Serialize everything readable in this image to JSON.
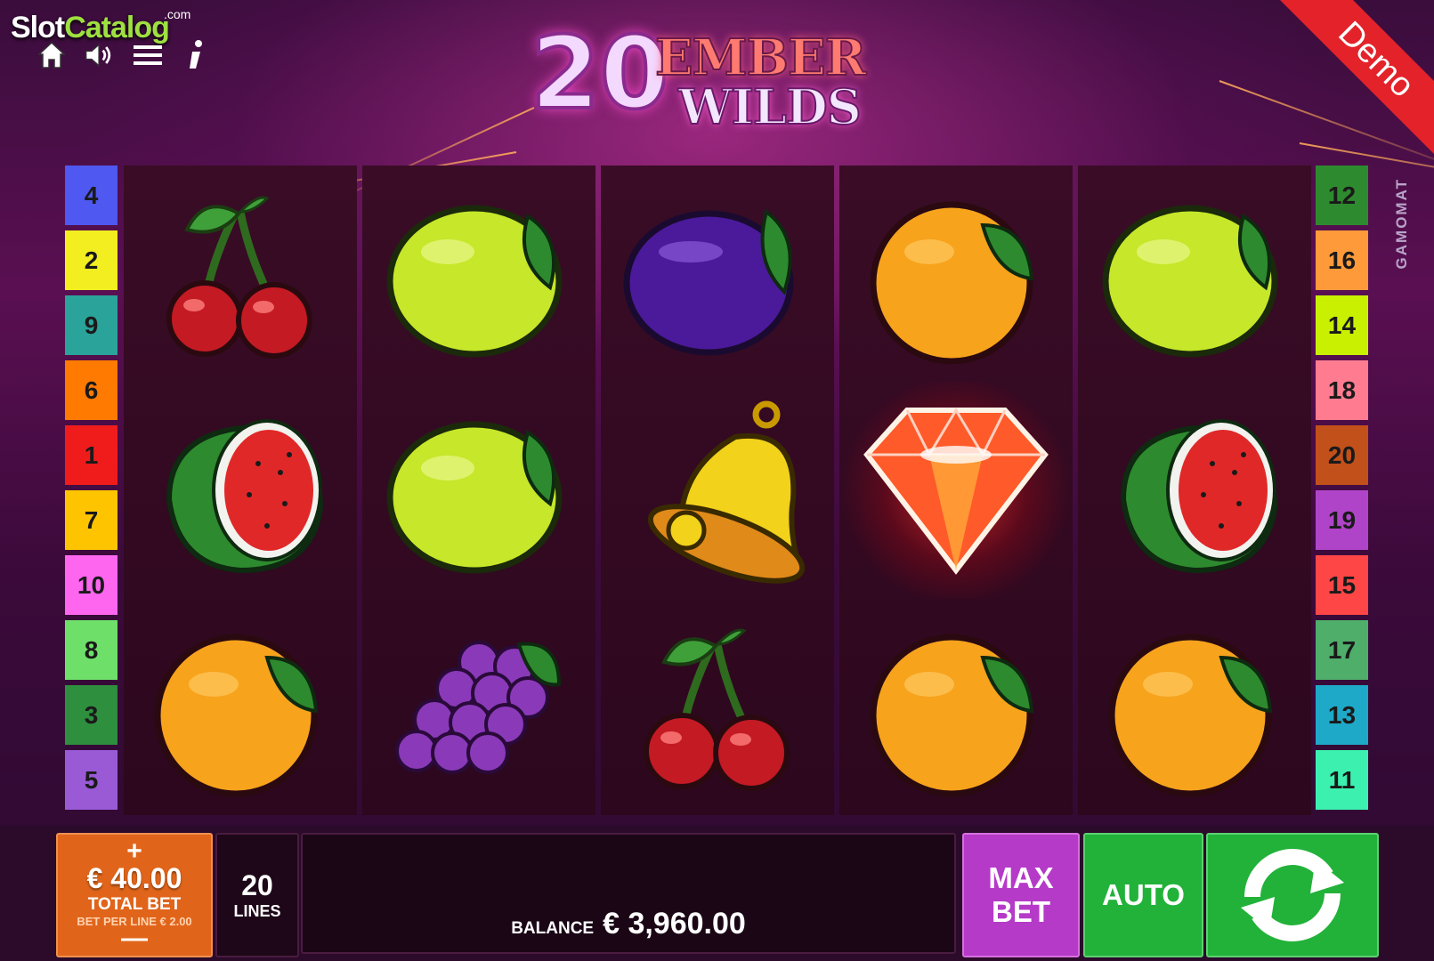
{
  "watermark": {
    "slot": "Slot",
    "catalog": "Catalog",
    "com": ".com"
  },
  "title": {
    "number": "20",
    "line1": "EMBER",
    "line2": "WILDS"
  },
  "demo_label": "Demo",
  "provider": "GAMOMAT",
  "top_icons": [
    "home-icon",
    "speaker-icon",
    "menu-icon",
    "info-icon"
  ],
  "lines_left": [
    {
      "n": "4",
      "color": "#4f58f0"
    },
    {
      "n": "2",
      "color": "#f2ee20"
    },
    {
      "n": "9",
      "color": "#2aa39a"
    },
    {
      "n": "6",
      "color": "#ff7a00"
    },
    {
      "n": "1",
      "color": "#f01c1c"
    },
    {
      "n": "7",
      "color": "#ffc400"
    },
    {
      "n": "10",
      "color": "#ff66f0"
    },
    {
      "n": "8",
      "color": "#6ee06a"
    },
    {
      "n": "3",
      "color": "#2e8f3e"
    },
    {
      "n": "5",
      "color": "#9a5ad6"
    }
  ],
  "lines_right": [
    {
      "n": "12",
      "color": "#2e8a2e"
    },
    {
      "n": "16",
      "color": "#ff9a3a"
    },
    {
      "n": "14",
      "color": "#c8f000"
    },
    {
      "n": "18",
      "color": "#ff7c90"
    },
    {
      "n": "20",
      "color": "#c2501a"
    },
    {
      "n": "19",
      "color": "#b044c8"
    },
    {
      "n": "15",
      "color": "#ff4646"
    },
    {
      "n": "17",
      "color": "#4eae6a"
    },
    {
      "n": "13",
      "color": "#1ea9c8"
    },
    {
      "n": "11",
      "color": "#3cf0b0"
    }
  ],
  "reels": [
    [
      "cherry",
      "watermelon",
      "orange"
    ],
    [
      "lemon",
      "lemon",
      "grapes"
    ],
    [
      "plum",
      "bell",
      "cherry"
    ],
    [
      "orange",
      "diamond",
      "orange"
    ],
    [
      "lemon",
      "watermelon",
      "orange"
    ]
  ],
  "bet": {
    "plus": "+",
    "value": "€ 40.00",
    "label": "TOTAL BET",
    "per_line": "BET PER LINE € 2.00",
    "minus": "—"
  },
  "lines": {
    "value": "20",
    "label": "LINES"
  },
  "balance": {
    "label": "BALANCE",
    "value": "€ 3,960.00"
  },
  "buttons": {
    "max_bet_1": "MAX",
    "max_bet_2": "BET",
    "auto": "AUTO",
    "spin_icon": "spin-arrows-icon"
  }
}
